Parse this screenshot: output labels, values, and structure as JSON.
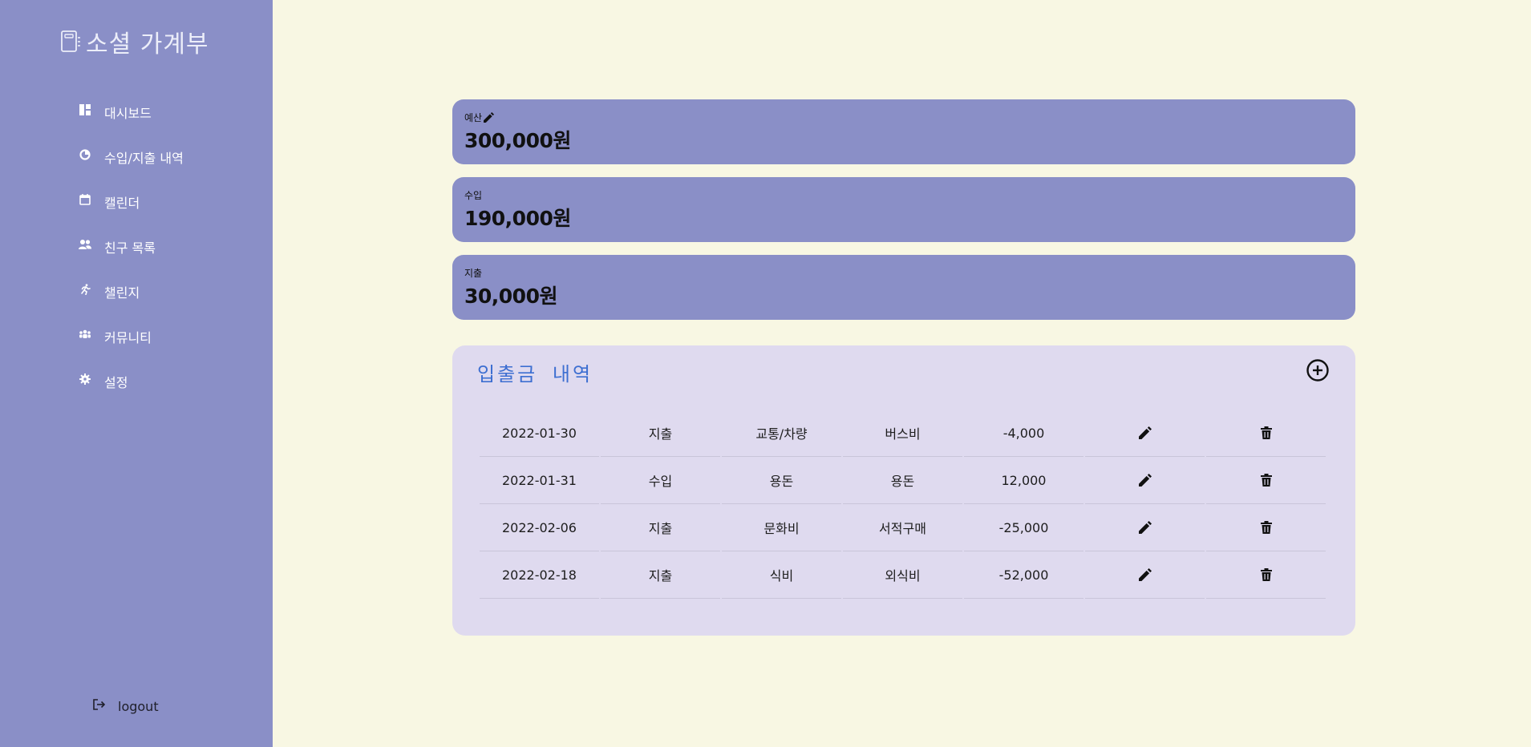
{
  "app": {
    "title": "소셜 가계부"
  },
  "sidebar": {
    "items": [
      {
        "label": "대시보드",
        "icon": "dashboard-icon"
      },
      {
        "label": "수입/지출 내역",
        "icon": "donut-chart-icon"
      },
      {
        "label": "캘린더",
        "icon": "calendar-icon"
      },
      {
        "label": "친구 목록",
        "icon": "people-icon"
      },
      {
        "label": "챌린지",
        "icon": "running-icon"
      },
      {
        "label": "커뮤니티",
        "icon": "groups-icon"
      },
      {
        "label": "설정",
        "icon": "gear-icon"
      }
    ],
    "logout_label": "logout"
  },
  "summary": {
    "budget": {
      "label": "예산",
      "value": "300,000원"
    },
    "income": {
      "label": "수입",
      "value": "190,000원"
    },
    "expense": {
      "label": "지출",
      "value": "30,000원"
    }
  },
  "history": {
    "title": "입출금 내역",
    "rows": [
      {
        "date": "2022-01-30",
        "type": "지출",
        "category": "교통/차량",
        "memo": "버스비",
        "amount": "-4,000"
      },
      {
        "date": "2022-01-31",
        "type": "수입",
        "category": "용돈",
        "memo": "용돈",
        "amount": "12,000"
      },
      {
        "date": "2022-02-06",
        "type": "지출",
        "category": "문화비",
        "memo": "서적구매",
        "amount": "-25,000"
      },
      {
        "date": "2022-02-18",
        "type": "지출",
        "category": "식비",
        "memo": "외식비",
        "amount": "-52,000"
      }
    ]
  },
  "colors": {
    "sidebar": "#8a8fc7",
    "background": "#f8f7e3",
    "panel": "#dfdaef",
    "accent": "#3e6fd1"
  }
}
